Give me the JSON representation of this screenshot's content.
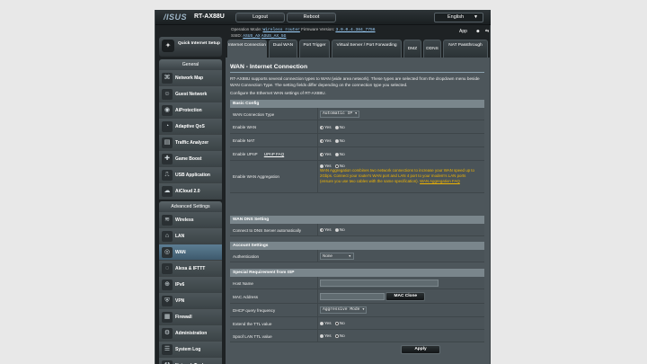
{
  "header": {
    "brand": "/ISUS",
    "model": "RT-AX88U",
    "logout_label": "Logout",
    "reboot_label": "Reboot",
    "language": "English"
  },
  "info": {
    "opmode_label": "Operation Mode:",
    "opmode_value": "Wireless router",
    "firmware_label": "Firmware Version:",
    "firmware_value": "3.0.0.4.384_7756",
    "ssid_label": "SSID:",
    "ssid_1": "ASUS_AX",
    "ssid_2": "ASUS_AX_5G",
    "app_label": "App"
  },
  "nav": {
    "qis_label": "Quick Internet Setup",
    "general_header": "General",
    "general_items": [
      {
        "label": "Network Map",
        "icon": "network-map-icon"
      },
      {
        "label": "Guest Network",
        "icon": "guest-network-icon"
      },
      {
        "label": "AiProtection",
        "icon": "aiprotection-icon"
      },
      {
        "label": "Adaptive QoS",
        "icon": "adaptive-qos-icon"
      },
      {
        "label": "Traffic Analyzer",
        "icon": "traffic-analyzer-icon"
      },
      {
        "label": "Game Boost",
        "icon": "game-boost-icon"
      },
      {
        "label": "USB Application",
        "icon": "usb-application-icon"
      },
      {
        "label": "AiCloud 2.0",
        "icon": "aicloud-icon"
      }
    ],
    "advanced_header": "Advanced Settings",
    "advanced_items": [
      {
        "label": "Wireless",
        "icon": "wireless-icon"
      },
      {
        "label": "LAN",
        "icon": "lan-icon"
      },
      {
        "label": "WAN",
        "icon": "wan-icon",
        "active": true
      },
      {
        "label": "Alexa & IFTTT",
        "icon": "alexa-icon"
      },
      {
        "label": "IPv6",
        "icon": "ipv6-icon"
      },
      {
        "label": "VPN",
        "icon": "vpn-icon"
      },
      {
        "label": "Firewall",
        "icon": "firewall-icon"
      },
      {
        "label": "Administration",
        "icon": "administration-icon"
      },
      {
        "label": "System Log",
        "icon": "system-log-icon"
      },
      {
        "label": "Network Tools",
        "icon": "network-tools-icon"
      }
    ]
  },
  "tabs": [
    {
      "label": "Internet Connection",
      "active": true
    },
    {
      "label": "Dual WAN"
    },
    {
      "label": "Port Trigger"
    },
    {
      "label": "Virtual Server / Port Forwarding"
    },
    {
      "label": "DMZ"
    },
    {
      "label": "DDNS"
    },
    {
      "label": "NAT Passthrough"
    }
  ],
  "page": {
    "title": "WAN - Internet Connection",
    "description": "RT-AX88U supports several connection types to WAN (wide area network). These types are selected from the dropdown menu beside WAN Connection Type. The setting fields differ depending on the connection type you selected.",
    "configure": "Configure the Ethernet WAN settings of RT-AX88U."
  },
  "basic": {
    "header": "Basic Config",
    "wan_type_label": "WAN Connection Type",
    "wan_type_value": "Automatic IP",
    "enable_wan_label": "Enable WAN",
    "enable_nat_label": "Enable NAT",
    "enable_upnp_label": "Enable UPnP",
    "upnp_faq": "UPnP FAQ",
    "wan_agg_label": "Enable WAN Aggregation",
    "wan_agg_note": "WAN Aggregation combines two network connections to increase your WAN speed up to 2Gbps. Connect your router's WAN port and LAN 4 port to your modem's LAN ports (ensure you use two cables with the same specification).",
    "wan_agg_faq": "WAN Aggregation FAQ"
  },
  "radio": {
    "yes": "Yes",
    "no": "No"
  },
  "dns": {
    "header": "WAN DNS Setting",
    "auto_label": "Connect to DNS Server automatically"
  },
  "account": {
    "header": "Account Settings",
    "auth_label": "Authentication",
    "auth_value": "None"
  },
  "isp": {
    "header": "Special Requirement from ISP",
    "host_label": "Host Name",
    "host_value": "",
    "mac_label": "MAC Address",
    "mac_value": "",
    "mac_clone": "MAC Clone",
    "dhcp_label": "DHCP query frequency",
    "dhcp_value": "Aggressive Mode",
    "ttl_label": "Extend the TTL value",
    "spoof_label": "Spoof LAN TTL value"
  },
  "apply_label": "Apply"
}
